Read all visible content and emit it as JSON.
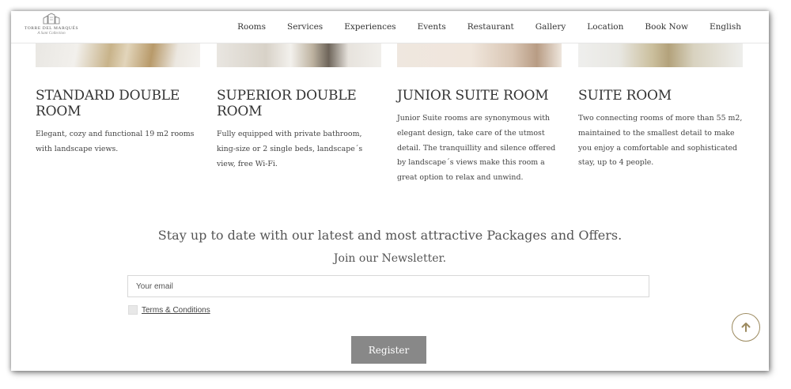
{
  "header": {
    "logo": {
      "name": "TORRE DEL MARQUÉS",
      "tagline": "A Sant Collection"
    },
    "nav": [
      "Rooms",
      "Services",
      "Experiences",
      "Events",
      "Restaurant",
      "Gallery",
      "Location",
      "Book Now",
      "English"
    ]
  },
  "rooms": [
    {
      "title": "STANDARD DOUBLE ROOM",
      "description": "Elegant, cozy and functional 19 m2 rooms with landscape views."
    },
    {
      "title": "SUPERIOR DOUBLE ROOM",
      "description": "Fully equipped with private bathroom, king-size or 2 single beds, landscape´s view, free Wi-Fi."
    },
    {
      "title": "JUNIOR SUITE ROOM",
      "description": "Junior Suite rooms are synonymous with elegant design, take care of the utmost detail. The tranquillity and silence offered by landscape´s views make this room a great option to relax and unwind."
    },
    {
      "title": "SUITE ROOM",
      "description": "Two connecting rooms of more than 55 m2, maintained to the smallest detail to make you enjoy a comfortable and sophisticated stay, up to 4 people."
    }
  ],
  "newsletter": {
    "title": "Stay up to date with our latest and most attractive Packages and Offers.",
    "subtitle": "Join our Newsletter.",
    "email_placeholder": "Your email",
    "email_value": "",
    "terms_label": "Terms & Conditions",
    "register_label": "Register"
  },
  "icons": {
    "logo": "tower-logo-icon",
    "scroll_top": "arrow-up-icon"
  },
  "colors": {
    "accent_gold": "#9c8a5f",
    "button_gray": "#888888"
  }
}
